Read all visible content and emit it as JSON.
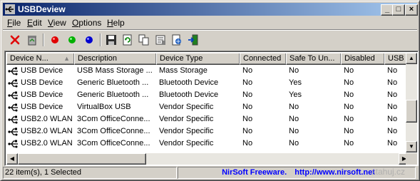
{
  "window": {
    "title": "USBDeview",
    "buttons": {
      "minimize": "_",
      "maximize": "□",
      "close": "×"
    }
  },
  "menu": [
    {
      "label": "File",
      "underline": "F",
      "rest": "ile"
    },
    {
      "label": "Edit",
      "underline": "E",
      "rest": "dit"
    },
    {
      "label": "View",
      "underline": "V",
      "rest": "iew"
    },
    {
      "label": "Options",
      "underline": "O",
      "rest": "ptions"
    },
    {
      "label": "Help",
      "underline": "H",
      "rest": "elp"
    }
  ],
  "toolbar": {
    "icons": [
      "disconnect-icon",
      "uninstall-icon",
      "red-led-icon",
      "green-led-icon",
      "blue-led-icon",
      "save-icon",
      "refresh-icon",
      "copy-icon",
      "properties-icon",
      "html-report-icon",
      "exit-icon"
    ]
  },
  "columns": [
    {
      "label": "Device N..."
    },
    {
      "label": "Description"
    },
    {
      "label": "Device Type"
    },
    {
      "label": "Connected"
    },
    {
      "label": "Safe To Un..."
    },
    {
      "label": "Disabled"
    },
    {
      "label": "USB H"
    }
  ],
  "rows": [
    [
      "USB Device",
      "USB Mass Storage ...",
      "Mass Storage",
      "No",
      "No",
      "No",
      "No"
    ],
    [
      "USB Device",
      "Generic Bluetooth ...",
      "Bluetooth Device",
      "No",
      "Yes",
      "No",
      "No"
    ],
    [
      "USB Device",
      "Generic Bluetooth ...",
      "Bluetooth Device",
      "No",
      "Yes",
      "No",
      "No"
    ],
    [
      "USB Device",
      "VirtualBox USB",
      "Vendor Specific",
      "No",
      "No",
      "No",
      "No"
    ],
    [
      "USB2.0 WLAN",
      "3Com OfficeConne...",
      "Vendor Specific",
      "No",
      "No",
      "No",
      "No"
    ],
    [
      "USB2.0 WLAN",
      "3Com OfficeConne...",
      "Vendor Specific",
      "No",
      "No",
      "No",
      "No"
    ],
    [
      "USB2.0 WLAN",
      "3Com OfficeConne...",
      "Vendor Specific",
      "No",
      "No",
      "No",
      "No"
    ]
  ],
  "status": {
    "count": "22 item(s), 1 Selected",
    "nirsoft": "NirSoft Freeware.",
    "url": "http://www.nirsoft.net",
    "watermark": "stahuj.cz"
  },
  "colors": {
    "title_start": "#0a246a",
    "title_end": "#a6caf0",
    "face": "#d4d0c8",
    "link": "#0000ff"
  }
}
